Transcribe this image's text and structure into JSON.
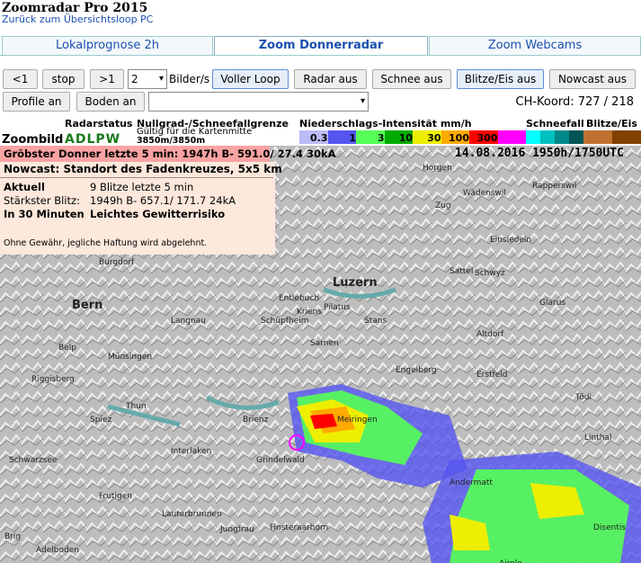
{
  "app": {
    "title": "Zoomradar Pro 2015",
    "back_link": "Zurück zum Übersichtsloop PC"
  },
  "tabs": [
    {
      "label": "Lokalprognose 2h"
    },
    {
      "label": "Zoom Donnerradar",
      "active": true
    },
    {
      "label": "Zoom Webcams"
    }
  ],
  "toolbar": {
    "prev": "<1",
    "stop": "stop",
    "next": ">1",
    "speed_value": "2",
    "speed_unit": "Bilder/s",
    "full_loop": "Voller Loop",
    "radar": "Radar aus",
    "snow": "Schnee aus",
    "lightning": "Blitze/Eis aus",
    "nowcast": "Nowcast aus",
    "profile": "Profile an",
    "ground": "Boden an",
    "location_value": "",
    "coord": "CH-Koord: 727 / 218"
  },
  "legend": {
    "zoombild": "Zoombild",
    "radarstatus_label": "Radarstatus",
    "radarstatus": "ADLPW",
    "freezing_label": "Nullgrad-/Schneefallgrenze",
    "freezing_note": "Gültig für die Kartenmitte",
    "freezing_value": "3850m/3850m",
    "precip_label": "Niederschlags-Intensität mm/h",
    "snow_label": "Schneefall",
    "lightning_label": "Blitze/Eis",
    "precip_scale": [
      {
        "color": "#bbbbf7",
        "label": "0.3"
      },
      {
        "color": "#5555f0",
        "label": "1"
      },
      {
        "color": "#55ff55",
        "label": "3"
      },
      {
        "color": "#00aa00",
        "label": "10"
      },
      {
        "color": "#eeee00",
        "label": "30"
      },
      {
        "color": "#ffaa00",
        "label": "100"
      },
      {
        "color": "#ff0000",
        "label": "300"
      },
      {
        "color": "#ff00ff",
        "label": ""
      }
    ],
    "snow_scale": [
      "#00ffff",
      "#00c0c0",
      "#008888",
      "#005555"
    ],
    "lightning_scale": [
      "#c07030",
      "#804000"
    ]
  },
  "strongest": "Gröbster Donner letzte 5 min: 1947h B- 591.0/  27.4  30kA",
  "datetime": "14.08.2016  1950h/1750UTC",
  "nowcast": {
    "title": "Nowcast: Standort des Fadenkreuzes, 5x5 km",
    "aktuell_label": "Aktuell",
    "aktuell_value": "9 Blitze letzte 5 min",
    "strongest_label": "Stärkster Blitz:",
    "strongest_value": "1949h B- 657.1/ 171.7  24kA",
    "in30_label": "In 30 Minuten",
    "in30_value": "Leichtes Gewitterrisiko",
    "disclaimer": "Ohne Gewähr, jegliche Haftung wird abgelehnt."
  },
  "places": [
    "Burgdorf",
    "Bern",
    "Luzern",
    "Schwyz",
    "Zug",
    "Wädenswil",
    "Rapperswil",
    "Horgen",
    "Thun",
    "Interlaken",
    "Frutigen",
    "Adelboden",
    "Altdorf",
    "Glarus",
    "Sarnen",
    "Stans",
    "Meiringen",
    "Grindelwald",
    "Andermatt",
    "Disentis",
    "Airolo",
    "Jungfrau",
    "Finsteraarhorn",
    "Tödi",
    "Entlebuch",
    "Schüpfheim",
    "Langnau",
    "Münsingen",
    "Spiez",
    "Brienz",
    "Engelberg",
    "Erstfeld",
    "Linthal",
    "Einsiedeln",
    "Sattel",
    "Kriens",
    "Pilatus",
    "Belp",
    "Riggisberg",
    "Schwarzsee",
    "Lauterbrunnen",
    "Brig"
  ]
}
